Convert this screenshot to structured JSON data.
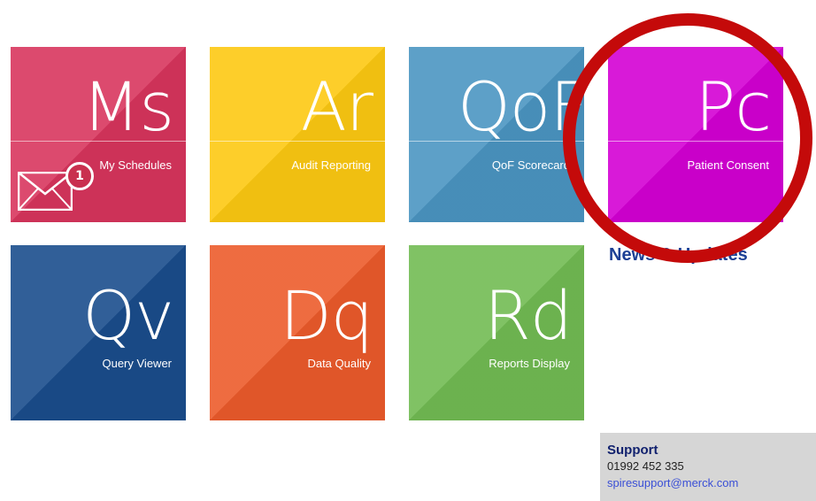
{
  "tiles": [
    {
      "id": "ms",
      "abbr": "Ms",
      "label": "My Schedules",
      "color": "#d8355d"
    },
    {
      "id": "ar",
      "abbr": "Ar",
      "label": "Audit Reporting",
      "color": "#fdc912"
    },
    {
      "id": "qof",
      "abbr": "QoF",
      "label": "QoF Scorecard",
      "color": "#4b95c2"
    },
    {
      "id": "pc",
      "abbr": "Pc",
      "label": "Patient Consent",
      "color": "#d400d4"
    },
    {
      "id": "qv",
      "abbr": "Qv",
      "label": "Query Viewer",
      "color": "#1a4d8c"
    },
    {
      "id": "dq",
      "abbr": "Dq",
      "label": "Data Quality",
      "color": "#ec5b2b"
    },
    {
      "id": "rd",
      "abbr": "Rd",
      "label": "Reports Display",
      "color": "#72bb53"
    }
  ],
  "notifications": {
    "icon": "envelope-icon",
    "count": "1"
  },
  "news": {
    "heading": "News & Updates"
  },
  "highlight": {
    "color": "#c40a0a",
    "shape": "circle"
  },
  "support": {
    "title": "Support",
    "phone": "01992 452 335",
    "email": "spiresupport@merck.com"
  }
}
